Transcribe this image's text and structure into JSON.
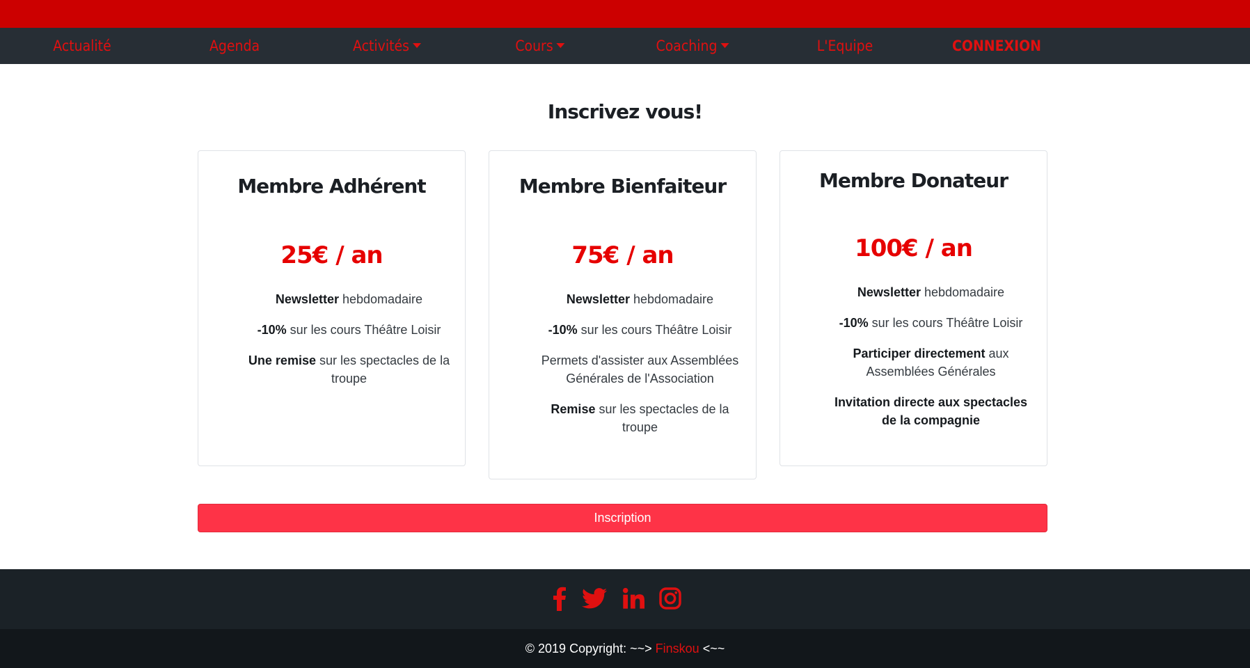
{
  "nav": {
    "items": [
      {
        "label": "Actualité",
        "dropdown": false
      },
      {
        "label": "Agenda",
        "dropdown": false
      },
      {
        "label": "Activités",
        "dropdown": true
      },
      {
        "label": "Cours",
        "dropdown": true
      },
      {
        "label": "Coaching",
        "dropdown": true
      },
      {
        "label": "L'Equipe",
        "dropdown": false
      },
      {
        "label": "CONNEXION",
        "dropdown": false
      }
    ]
  },
  "main": {
    "heading": "Inscrivez vous!",
    "cards": [
      {
        "title": "Membre Adhérent",
        "price": "25€ / an",
        "features": [
          {
            "bold": "Newsletter",
            "text": " hebdomadaire"
          },
          {
            "bold": "-10%",
            "text": " sur les cours Théâtre Loisir"
          },
          {
            "bold": "Une remise",
            "text": " sur les spectacles de la troupe"
          }
        ]
      },
      {
        "title": "Membre Bienfaiteur",
        "price": "75€ / an",
        "features": [
          {
            "bold": "Newsletter",
            "text": " hebdomadaire"
          },
          {
            "bold": "-10%",
            "text": " sur les cours Théâtre Loisir"
          },
          {
            "bold": "",
            "text": "Permets d'assister aux Assemblées Générales de l'Association"
          },
          {
            "bold": "Remise",
            "text": " sur les spectacles de la troupe"
          }
        ]
      },
      {
        "title": "Membre Donateur",
        "price": "100€ / an",
        "features": [
          {
            "bold": "Newsletter",
            "text": " hebdomadaire"
          },
          {
            "bold": "-10%",
            "text": " sur les cours Théâtre Loisir"
          },
          {
            "bold": "Participer directement",
            "text": " aux Assemblées Générales"
          },
          {
            "bold": "Invitation directe aux spectacles de la compagnie",
            "text": ""
          }
        ]
      }
    ],
    "signup_label": "Inscription"
  },
  "footer": {
    "social_icons": [
      "facebook-icon",
      "twitter-icon",
      "linkedin-icon",
      "instagram-icon"
    ],
    "copyright_prefix": "© 2019 Copyright: ~~> ",
    "copyright_link": "Finskou",
    "copyright_suffix": " <~~"
  },
  "colors": {
    "accent": "#e01010",
    "top_band": "#cc0000",
    "navbar": "#272e35",
    "button": "#fe3347",
    "footer": "#1b2227",
    "footer_bottom": "#12171b"
  }
}
